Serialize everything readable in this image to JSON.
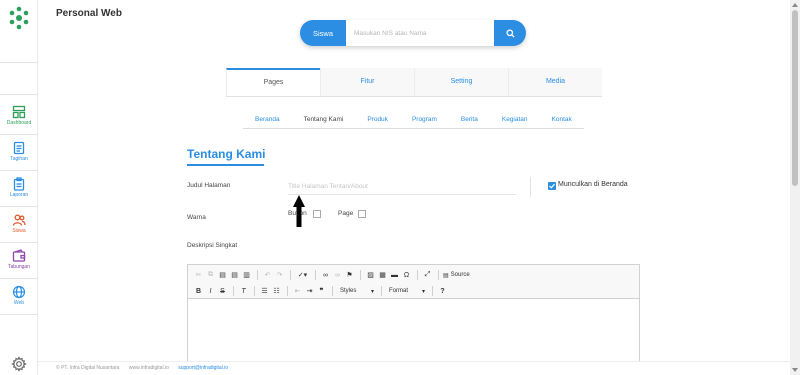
{
  "app": {
    "title": "Personal Web"
  },
  "sidebar": {
    "items": [
      {
        "label": "Dashboard",
        "icon": "dashboard-icon",
        "color": "#2e9e5b"
      },
      {
        "label": "Tagihan",
        "icon": "document-icon",
        "color": "#2b8ee3"
      },
      {
        "label": "Laporan",
        "icon": "clipboard-icon",
        "color": "#2b8ee3"
      },
      {
        "label": "Siswa",
        "icon": "users-icon",
        "color": "#e05a2b"
      },
      {
        "label": "Tabungan",
        "icon": "wallet-icon",
        "color": "#8e44ad"
      },
      {
        "label": "Web",
        "icon": "globe-icon",
        "color": "#2b8ee3"
      }
    ]
  },
  "search": {
    "tag": "Siswa",
    "placeholder": "Masukan NIS atau Nama",
    "value": ""
  },
  "tabs": [
    {
      "label": "Pages",
      "active": true
    },
    {
      "label": "Fitur",
      "active": false
    },
    {
      "label": "Setting",
      "active": false
    },
    {
      "label": "Media",
      "active": false
    }
  ],
  "subnav": [
    {
      "label": "Beranda",
      "active": false
    },
    {
      "label": "Tentang Kami",
      "active": true
    },
    {
      "label": "Produk",
      "active": false
    },
    {
      "label": "Program",
      "active": false
    },
    {
      "label": "Berita",
      "active": false
    },
    {
      "label": "Kegiatan",
      "active": false
    },
    {
      "label": "Kontak",
      "active": false
    }
  ],
  "form": {
    "section_title": "Tentang Kami",
    "judul_label": "Judul Halaman",
    "judul_placeholder": "Title Halaman Tentan/About",
    "judul_value": "",
    "show_home_label": "Munculkan di Beranda",
    "show_home_checked": true,
    "warna_label": "Warna",
    "warna_opt1": "Button",
    "warna_opt2": "Page",
    "deskripsi_label": "Deskripsi Singkat"
  },
  "editor": {
    "source_label": "Source",
    "styles_label": "Styles",
    "format_label": "Format",
    "content": ""
  },
  "footer": {
    "copyright": "© PT. Infra Digital Nusantara",
    "website": "www.infradigital.io",
    "email": "support@infradigital.io"
  },
  "colors": {
    "accent": "#2b8ee3",
    "brand_green": "#2e9e5b"
  }
}
